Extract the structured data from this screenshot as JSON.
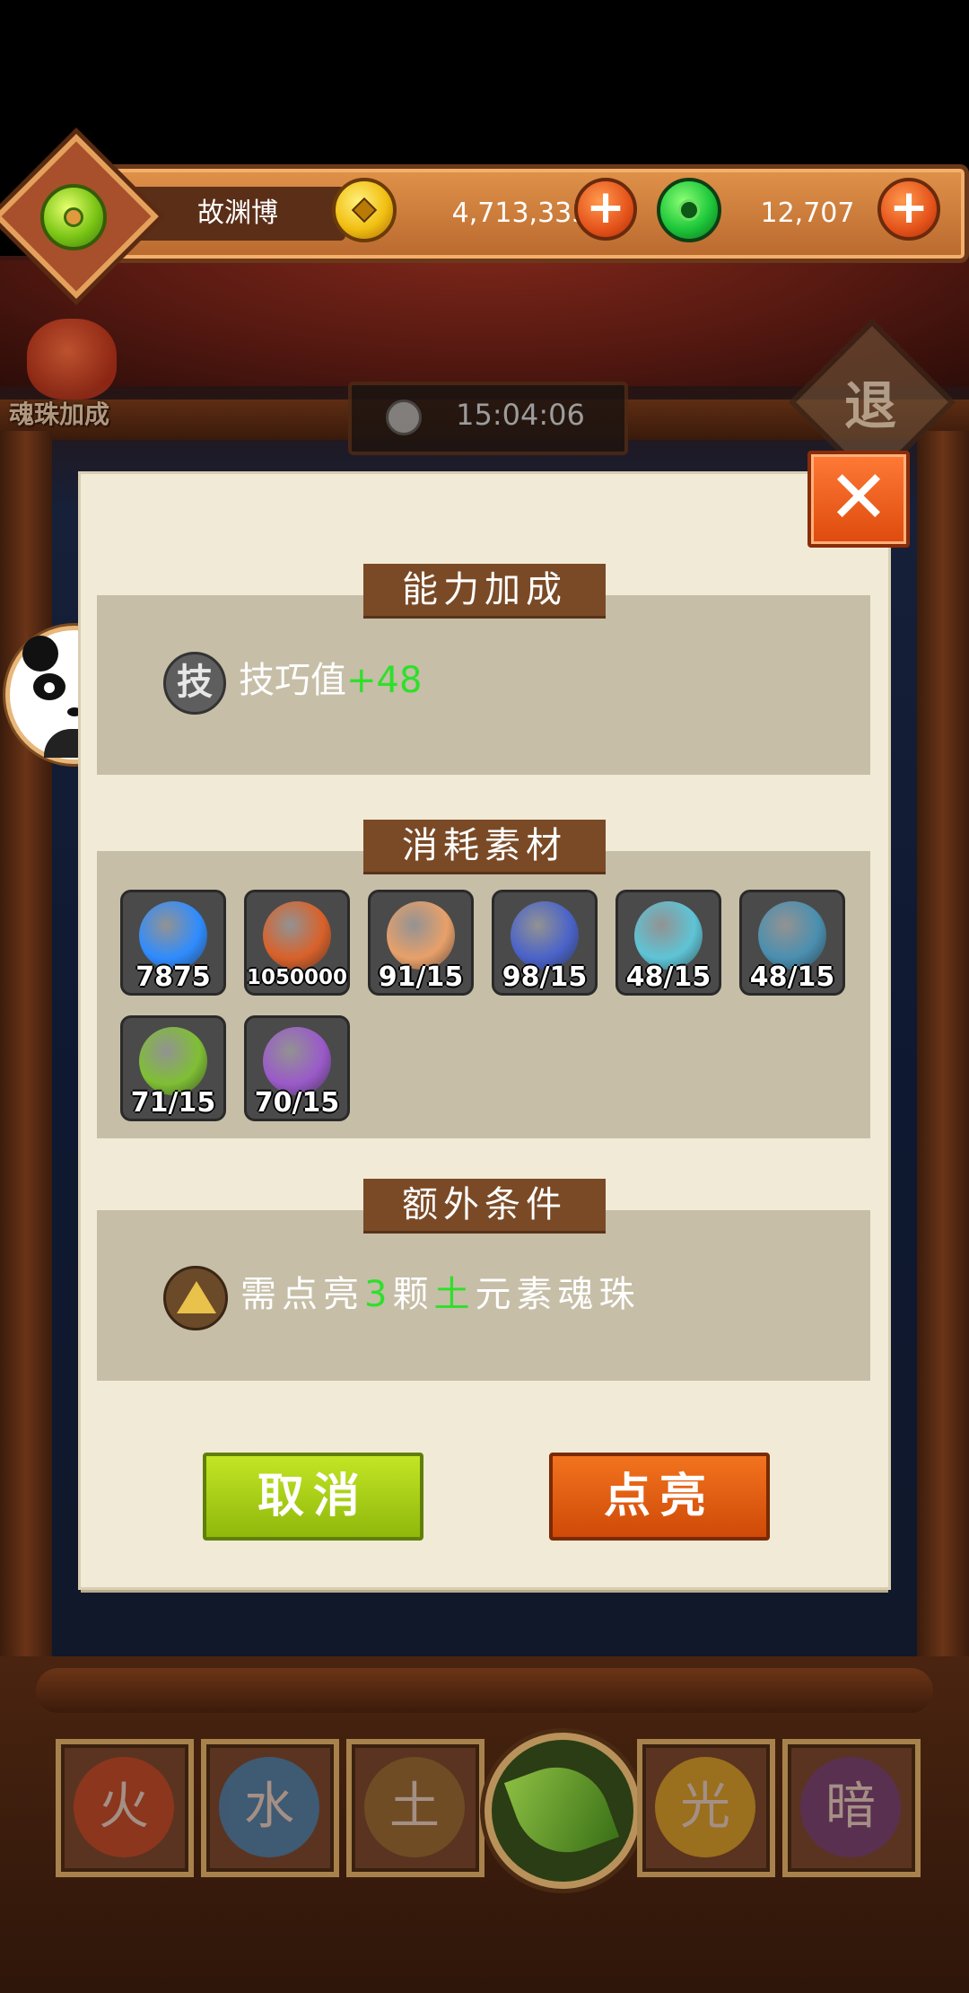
{
  "header": {
    "player_name": "故渊博",
    "gold_amount": "4,713,335",
    "jade_amount": "12,707"
  },
  "background": {
    "soul_bonus_label": "魂珠加成",
    "timer": "15:04:06",
    "exit_label": "退"
  },
  "dialog": {
    "ability_title": "能力加成",
    "skill_icon_char": "技",
    "skill_label": "技巧值",
    "skill_bonus": "+48",
    "materials_title": "消耗素材",
    "materials": [
      {
        "icon": "blue-flame-icon",
        "count": "7875",
        "color": "#2f8cff"
      },
      {
        "icon": "coin-bag-icon",
        "count": "1050000",
        "color": "#d9612a"
      },
      {
        "icon": "muscle-orb-icon",
        "count": "91/15",
        "color": "#e8a06a"
      },
      {
        "icon": "crystal-orb-icon",
        "count": "98/15",
        "color": "#4a63c9"
      },
      {
        "icon": "puzzle-orb-icon",
        "count": "48/15",
        "color": "#5ec4d6"
      },
      {
        "icon": "eye-orb-icon",
        "count": "48/15",
        "color": "#4a8fb0"
      },
      {
        "icon": "clover-orb-icon",
        "count": "71/15",
        "color": "#7fbf34"
      },
      {
        "icon": "seed-orb-icon",
        "count": "70/15",
        "color": "#9a5ac9"
      }
    ],
    "extra_title": "额外条件",
    "condition": {
      "prefix": "需点亮",
      "number": "3",
      "middle": "颗",
      "element": "土",
      "suffix": "元素魂珠"
    },
    "cancel_label": "取消",
    "confirm_label": "点亮",
    "close_label": "✕"
  },
  "elements": [
    "火",
    "水",
    "土",
    "木",
    "光",
    "暗"
  ]
}
